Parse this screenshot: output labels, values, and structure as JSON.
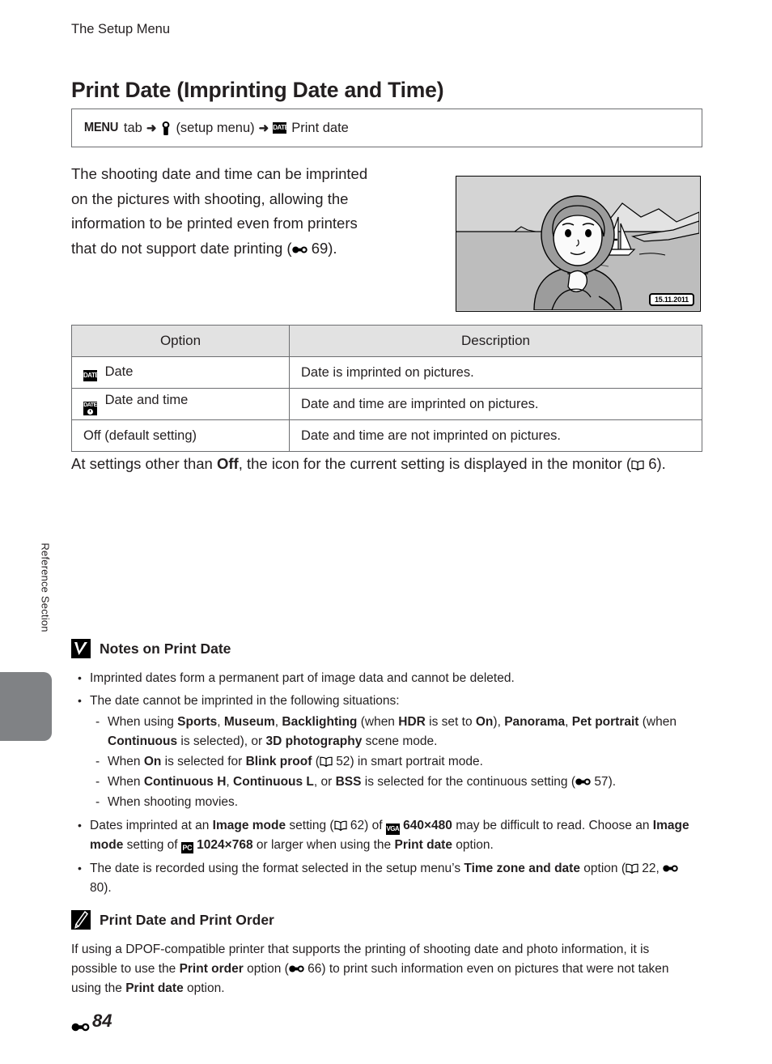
{
  "side_tab": {
    "label": "Reference Section"
  },
  "header": {
    "running_head": "The Setup Menu"
  },
  "title": "Print Date (Imprinting Date and Time)",
  "nav_path": {
    "menu_label": "MENU",
    "tab_word": "tab",
    "arrow": "➜",
    "setup_menu_text": "(setup menu)",
    "destination": "Print date"
  },
  "intro": {
    "line1": "The shooting date and time can be imprinted",
    "line2": "on the pictures with shooting, allowing the",
    "line3": "information to be printed even from printers",
    "line4_pre": "that do not support date printing (",
    "line4_ref": "69",
    "line4_post": ")."
  },
  "monitor": {
    "date_stamp": "15.11.2011"
  },
  "table": {
    "headers": [
      "Option",
      "Description"
    ],
    "rows": [
      {
        "icon": "date-icon",
        "option": "Date",
        "description": "Date is imprinted on pictures."
      },
      {
        "icon": "date-time-icon",
        "option": "Date and time",
        "description": "Date and time are imprinted on pictures."
      },
      {
        "icon": "none",
        "option": "Off (default setting)",
        "description": "Date and time are not imprinted on pictures."
      }
    ]
  },
  "after_table": {
    "pre": "At settings other than ",
    "bold": "Off",
    "mid": ", the icon for the current setting is displayed in the monitor (",
    "ref": "6",
    "post": ")."
  },
  "notes": {
    "heading": "Notes on Print Date",
    "bullet1": "Imprinted dates form a permanent part of image data and cannot be deleted.",
    "bullet2": "The date cannot be imprinted in the following situations:",
    "sub1": {
      "t1": "When using ",
      "b1": "Sports",
      "t2": ", ",
      "b2": "Museum",
      "t3": ", ",
      "b3": "Backlighting",
      "t4": " (when ",
      "b4": "HDR",
      "t5": " is set to ",
      "b5": "On",
      "t6": "), ",
      "b6": "Panorama",
      "t7": ", ",
      "b7": "Pet portrait",
      "t8": " (when ",
      "b8": "Continuous",
      "t9": " is selected), or ",
      "b9": "3D photography",
      "t10": " scene mode."
    },
    "sub2": {
      "t1": "When ",
      "b1": "On",
      "t2": " is selected for ",
      "b2": "Blink proof",
      "t3": " (",
      "ref": "52",
      "t4": ") in smart portrait mode."
    },
    "sub3": {
      "t1": "When ",
      "b1": "Continuous H",
      "t2": ", ",
      "b2": "Continuous L",
      "t3": ", or ",
      "b3": "BSS",
      "t4": " is selected for the continuous setting (",
      "ref": "57",
      "t5": ")."
    },
    "sub4": "When shooting movies.",
    "bullet3": {
      "t1": "Dates imprinted at an ",
      "b1": "Image mode",
      "t2": " setting (",
      "ref1": "62",
      "t3": ") of ",
      "b2": "640×480",
      "t4": " may be difficult to read. Choose an ",
      "b3": "Image mode",
      "t5": " setting of ",
      "b4": "1024×768",
      "t6": " or larger when using the ",
      "b5": "Print date",
      "t7": " option."
    },
    "bullet4": {
      "t1": "The date is recorded using the format selected in the setup menu’s ",
      "b1": "Time zone and date",
      "t2": " option (",
      "ref1": "22",
      "t3": ", ",
      "ref2": "80",
      "t4": ")."
    }
  },
  "tip": {
    "heading": "Print Date and Print Order",
    "t1": "If using a DPOF-compatible printer that supports the printing of shooting date and photo information, it is possible to use the ",
    "b1": "Print order",
    "t2": " option (",
    "ref": "66",
    "t3": ") to print such information even on pictures that were not taken using the ",
    "b2": "Print date",
    "t4": " option."
  },
  "footer": {
    "page_number": "84"
  }
}
